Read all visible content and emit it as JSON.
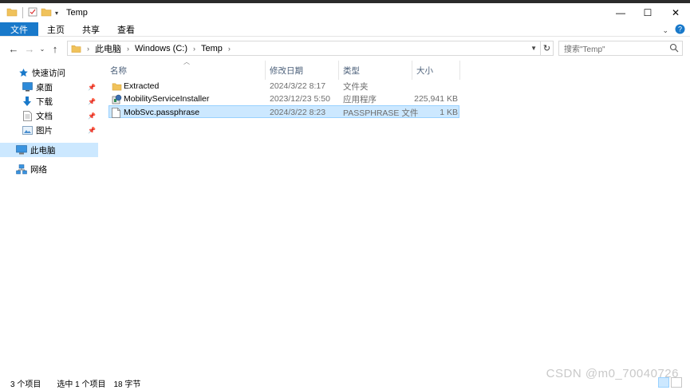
{
  "window": {
    "title": "Temp",
    "minimize_glyph": "—",
    "maximize_glyph": "☐",
    "close_glyph": "✕"
  },
  "ribbon": {
    "tabs": [
      "文件",
      "主页",
      "共享",
      "查看"
    ]
  },
  "address": {
    "crumbs": [
      "此电脑",
      "Windows (C:)",
      "Temp"
    ]
  },
  "search": {
    "placeholder": "搜索\"Temp\""
  },
  "sidebar": {
    "items": [
      {
        "label": "快速访问",
        "icon": "star-icon"
      },
      {
        "label": "桌面",
        "icon": "desktop-icon",
        "pinned": true
      },
      {
        "label": "下载",
        "icon": "download-icon",
        "pinned": true
      },
      {
        "label": "文档",
        "icon": "document-icon",
        "pinned": true
      },
      {
        "label": "图片",
        "icon": "picture-icon",
        "pinned": true
      },
      {
        "label": "此电脑",
        "icon": "computer-icon",
        "selected": true
      },
      {
        "label": "网络",
        "icon": "network-icon"
      }
    ]
  },
  "columns": {
    "name": "名称",
    "date": "修改日期",
    "type": "类型",
    "size": "大小"
  },
  "files": [
    {
      "name": "Extracted",
      "date": "2024/3/22 8:17",
      "type": "文件夹",
      "size": "",
      "icon": "folder-icon"
    },
    {
      "name": "MobilityServiceInstaller",
      "date": "2023/12/23 5:50",
      "type": "应用程序",
      "size": "225,941 KB",
      "icon": "installer-icon"
    },
    {
      "name": "MobSvc.passphrase",
      "date": "2024/3/22 8:23",
      "type": "PASSPHRASE 文件",
      "size": "1 KB",
      "icon": "file-icon",
      "selected": true
    }
  ],
  "status": {
    "count": "3 个项目",
    "selected": "选中 1 个项目",
    "size": "18 字节"
  },
  "watermark": "CSDN @m0_70040726",
  "colors": {
    "accent": "#1979ca",
    "selection": "#cce8ff",
    "folder": "#f0c25b"
  }
}
